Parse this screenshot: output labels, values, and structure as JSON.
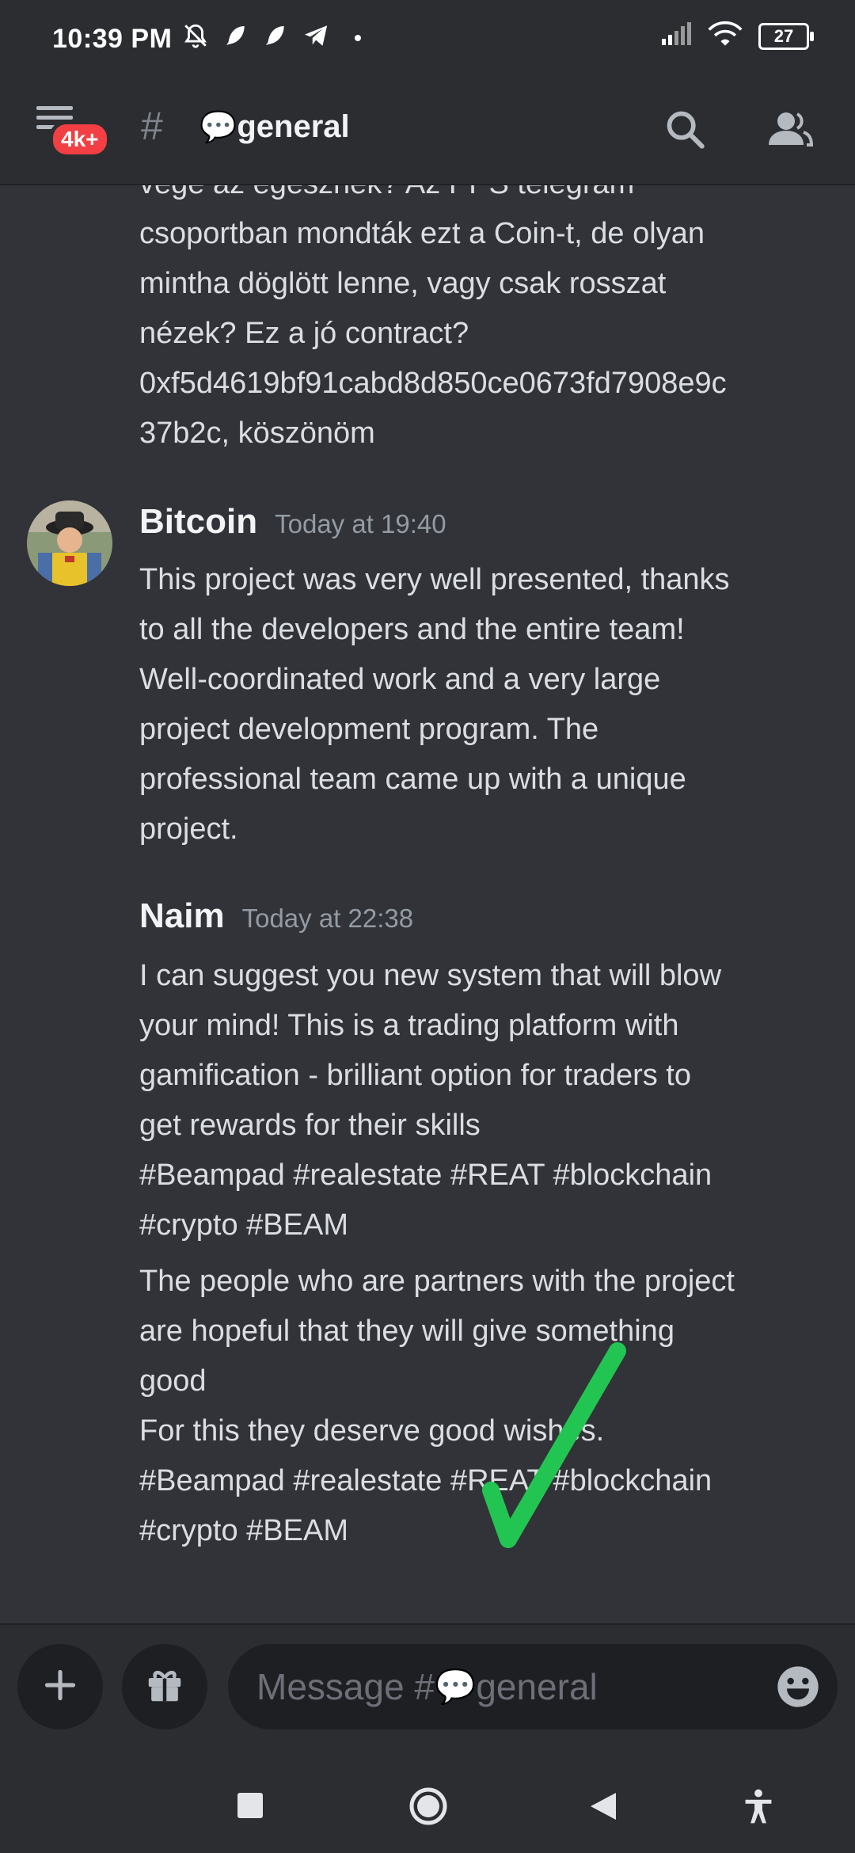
{
  "status": {
    "time": "10:39 PM",
    "battery": "27"
  },
  "header": {
    "badge": "4k+",
    "channel_emoji": "💬",
    "channel_name": "general"
  },
  "messages": {
    "prev_line0": "vége az egésznek? Az PPS telegram",
    "prev_line1": "csoportban mondták ezt a Coin-t, de olyan",
    "prev_line2": "mintha döglött lenne, vagy csak rosszat",
    "prev_line3": "nézek? Ez a jó contract?",
    "prev_line4": "0xf5d4619bf91cabd8d850ce0673fd7908e9c",
    "prev_line5": "37b2c, köszönöm",
    "m1_author": "Bitcoin",
    "m1_time": "Today at 19:40",
    "m1_line0": "This project was very well presented, thanks",
    "m1_line1": "to all the developers and the entire team!",
    "m1_line2": "Well-coordinated work and a very large",
    "m1_line3": "project development program. The",
    "m1_line4": "professional team came up with a unique",
    "m1_line5": "project.",
    "m2_author": "Naim",
    "m2_time": "Today at 22:38",
    "m2_line0": "I can suggest you new  system that will blow",
    "m2_line1": "your mind! This is a trading platform with",
    "m2_line2": "gamification - brilliant option for traders to",
    "m2_line3": "get rewards for their skills",
    "m2_line4": "#Beampad #realestate #REAT #blockchain",
    "m2_line5": "#crypto #BEAM",
    "m3_line0": "The people who are partners with the project",
    "m3_line1": "are hopeful that they will give something",
    "m3_line2": "good",
    "m3_line3": "For this they deserve good wishes.",
    "m3_line4": "#Beampad #realestate #REAT #blockchain",
    "m3_line5": "#crypto #BEAM"
  },
  "composer": {
    "placeholder_prefix": "Message #",
    "placeholder_emoji": "💬",
    "placeholder_channel": "general"
  },
  "colors": {
    "background": "#313338",
    "bar": "#2b2d31",
    "badge": "#f23f43",
    "checkmark": "#23c552"
  },
  "icons": [
    "bell-off-icon",
    "feather-icon",
    "feather-icon",
    "telegram-icon",
    "signal-icon",
    "wifi-icon",
    "battery-icon",
    "menu-icon",
    "hash-icon",
    "search-icon",
    "members-icon",
    "plus-icon",
    "gift-icon",
    "emoji-icon",
    "recents-icon",
    "home-icon",
    "back-icon",
    "accessibility-icon",
    "checkmark-icon"
  ]
}
